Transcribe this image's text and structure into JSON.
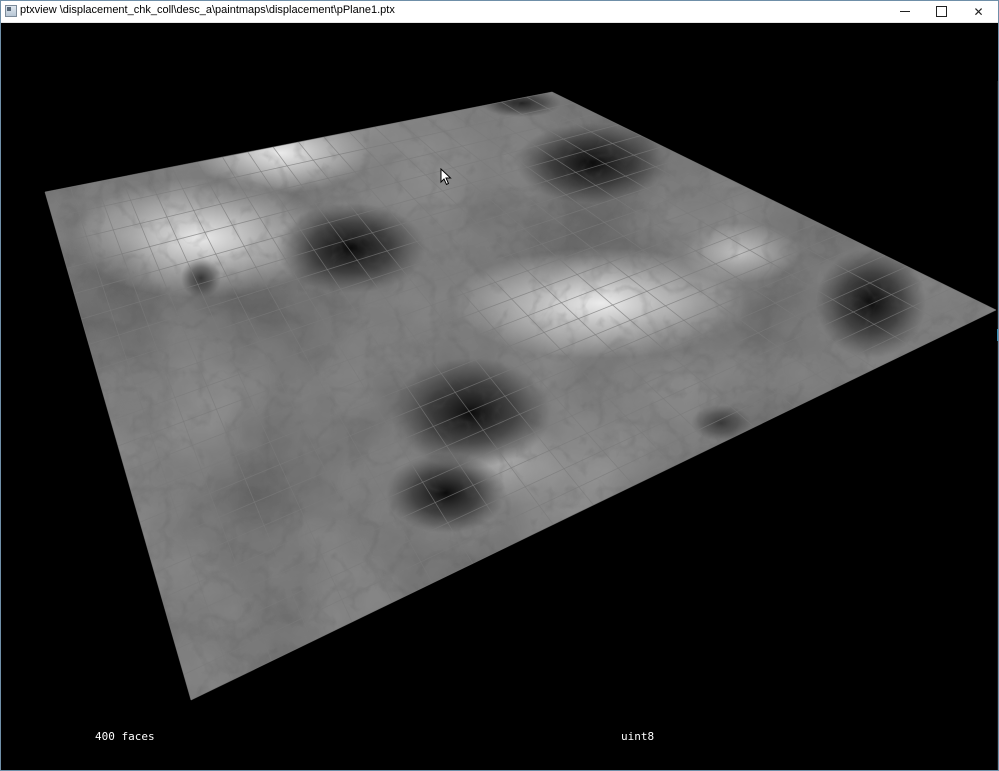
{
  "window": {
    "title": "ptxview \\displacement_chk_coll\\desc_a\\paintmaps\\displacement\\pPlane1.ptx",
    "minimize_label": "—",
    "maximize_label": "",
    "close_label": "✕"
  },
  "viewport": {
    "face_count_label": "400 faces",
    "data_type_label": "uint8",
    "grid_divisions": 20
  },
  "colors": {
    "background": "#000000",
    "grid_line": "#7a7a7a",
    "title_bar": "#ffffff"
  },
  "icons": {
    "app": "app-icon",
    "cursor": "mouse-pointer-icon"
  }
}
